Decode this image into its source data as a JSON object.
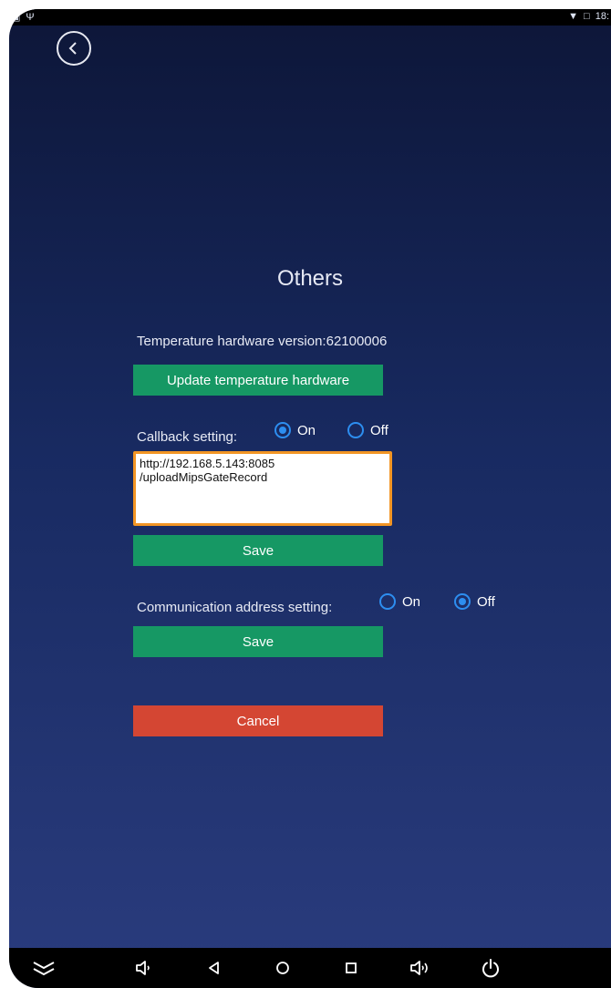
{
  "statusbar": {
    "left_icons": [
      "image-icon",
      "usb-icon"
    ],
    "right_icons": [
      "wifi-icon",
      "no-sim-icon"
    ],
    "time": "18:"
  },
  "page": {
    "title": "Others",
    "temperature_version_label": "Temperature hardware version:62100006",
    "update_button_label": "Update temperature hardware",
    "callback": {
      "label": "Callback setting:",
      "options": [
        {
          "label": "On",
          "selected": true
        },
        {
          "label": "Off",
          "selected": false
        }
      ],
      "url_value": "http://192.168.5.143:8085\n/uploadMipsGateRecord",
      "save_label": "Save"
    },
    "communication": {
      "label": "Communication address setting:",
      "options": [
        {
          "label": "On",
          "selected": false
        },
        {
          "label": "Off",
          "selected": true
        }
      ],
      "save_label": "Save"
    },
    "cancel_label": "Cancel"
  },
  "navbar": {
    "items": [
      "hide-bar-icon",
      "volume-down-icon",
      "back-icon",
      "home-icon",
      "recents-icon",
      "volume-up-icon",
      "power-icon"
    ]
  },
  "colors": {
    "background_top": "#0d1638",
    "background_bottom": "#2a3c7e",
    "button_green": "#169864",
    "button_red": "#d44633",
    "radio_blue": "#2d8ef0",
    "input_border": "#f29524"
  }
}
